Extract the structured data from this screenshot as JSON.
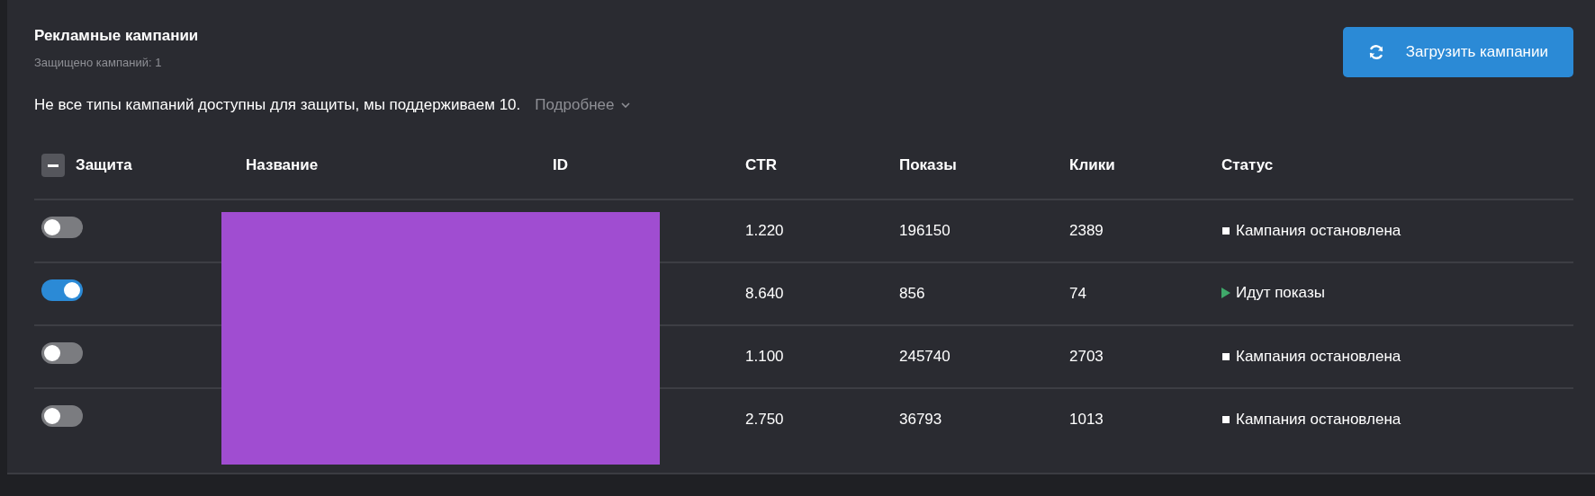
{
  "panel": {
    "title": "Рекламные кампании",
    "subtitle": "Защищено кампаний: 1",
    "load_button": "Загрузить кампании",
    "notice": "Не все типы кампаний доступны для защиты, мы поддерживаем 10.",
    "more_link": "Подробнее"
  },
  "table": {
    "select_all": {
      "indeterminate": true
    },
    "columns": [
      "Защита",
      "Название",
      "ID",
      "CTR",
      "Показы",
      "Клики",
      "Статус"
    ],
    "rows": [
      {
        "protected": false,
        "ctr": "1.220",
        "impressions": "196150",
        "clicks": "2389",
        "status": {
          "kind": "stopped",
          "text": "Кампания остановлена"
        }
      },
      {
        "protected": true,
        "ctr": "8.640",
        "impressions": "856",
        "clicks": "74",
        "status": {
          "kind": "running",
          "text": "Идут показы"
        }
      },
      {
        "protected": false,
        "ctr": "1.100",
        "impressions": "245740",
        "clicks": "2703",
        "status": {
          "kind": "stopped",
          "text": "Кампания остановлена"
        }
      },
      {
        "protected": false,
        "ctr": "2.750",
        "impressions": "36793",
        "clicks": "1013",
        "status": {
          "kind": "stopped",
          "text": "Кампания остановлена"
        }
      }
    ]
  }
}
